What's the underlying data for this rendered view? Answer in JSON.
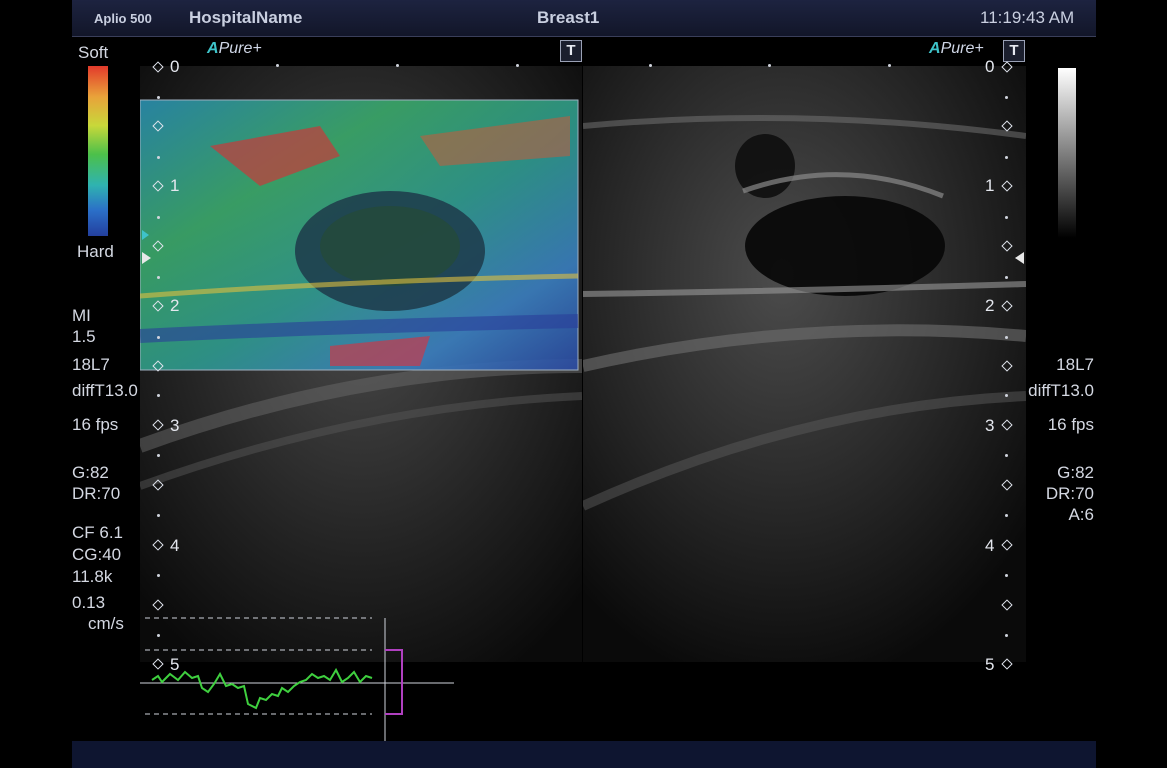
{
  "header": {
    "system": "Aplio 500",
    "hospital": "HospitalName",
    "preset": "Breast1",
    "time": "11:19:43 AM"
  },
  "scale": {
    "top_label": "Soft",
    "bottom_label": "Hard"
  },
  "badges": {
    "apure_a": "A",
    "apure_text": "Pure+",
    "t_button": "T"
  },
  "depth_marks": [
    "0",
    "1",
    "2",
    "3",
    "4",
    "5"
  ],
  "left_params": {
    "mi_label": "MI",
    "mi_value": "1.5",
    "probe": "18L7",
    "mode": "diffT13.0",
    "fps": "16 fps",
    "gain": "G:82",
    "dr": "DR:70",
    "cf": "CF 6.1",
    "cg": "CG:40",
    "prf": "11.8k",
    "velocity": "0.13",
    "velocity_unit": "cm/s"
  },
  "right_params": {
    "probe": "18L7",
    "mode": "diffT13.0",
    "fps": "16 fps",
    "gain": "G:82",
    "dr": "DR:70",
    "a": "A:6"
  },
  "colors": {
    "scale_top": "#d83a2a",
    "scale_bottom": "#2a4aa8",
    "strain_trace": "#3fd03f",
    "bracket": "#b040c0"
  }
}
